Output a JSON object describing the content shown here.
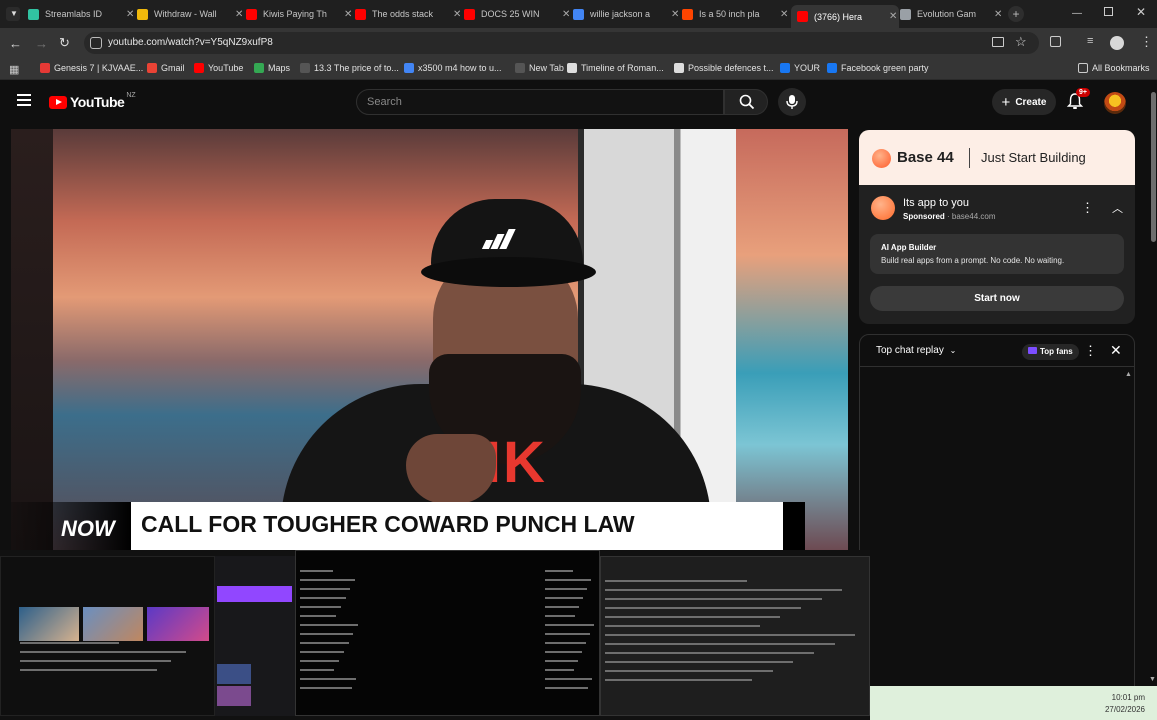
{
  "browser": {
    "tabs": [
      {
        "label": "Streamlabs ID",
        "color": "#31c3a2"
      },
      {
        "label": "Withdraw - Wall",
        "color": "#f0b90b"
      },
      {
        "label": "Kiwis Paying Th",
        "color": "#ff0000"
      },
      {
        "label": "The odds stack",
        "color": "#ff0000"
      },
      {
        "label": "DOCS 25 WIN",
        "color": "#ff0000"
      },
      {
        "label": "willie jackson a",
        "color": "#4285f4"
      },
      {
        "label": "Is a 50 inch pla",
        "color": "#ff4500"
      },
      {
        "label": "(3766) Hera",
        "color": "#ff0000"
      },
      {
        "label": "Evolution Gam",
        "color": "#9aa0a6"
      }
    ],
    "url": "youtube.com/watch?v=Y5qNZ9xufP8",
    "bookmarks": [
      {
        "label": "Genesis 7 | KJVAAE...",
        "color": "#e53935"
      },
      {
        "label": "Gmail",
        "color": "#ea4335"
      },
      {
        "label": "YouTube",
        "color": "#ff0000"
      },
      {
        "label": "Maps",
        "color": "#34a853"
      },
      {
        "label": "13.3 The price of to...",
        "color": "#555555"
      },
      {
        "label": "x3500 m4 how to u...",
        "color": "#4285f4"
      },
      {
        "label": "New Tab",
        "color": "#555555"
      },
      {
        "label": "Timeline of Roman...",
        "color": "#dddddd"
      },
      {
        "label": "Possible defences t...",
        "color": "#dddddd"
      },
      {
        "label": "YOUR",
        "color": "#1877f2"
      },
      {
        "label": "Facebook green party",
        "color": "#1877f2"
      }
    ],
    "all_bookmarks": "All Bookmarks"
  },
  "youtube": {
    "logo": "YouTube",
    "region": "NZ",
    "search_placeholder": "Search",
    "create_label": "Create",
    "notification_count": "9+"
  },
  "video": {
    "lower_third_tag": "NOW",
    "headline": "CALL FOR TOUGHER COWARD PUNCH LAW",
    "shirt_text": "KIK"
  },
  "ad": {
    "brand": "Base 44",
    "banner_tagline": "Just Start Building",
    "title": "Its app to you",
    "sponsored": "Sponsored",
    "domain": "base44.com",
    "feature_title": "AI App Builder",
    "feature_desc": "Build real apps from a prompt. No code. No waiting.",
    "cta": "Start now"
  },
  "chat": {
    "mode": "Top chat replay",
    "top_fans": "Top fans"
  },
  "taskbar": {
    "time": "10:01 pm",
    "date": "27/02/2026"
  }
}
